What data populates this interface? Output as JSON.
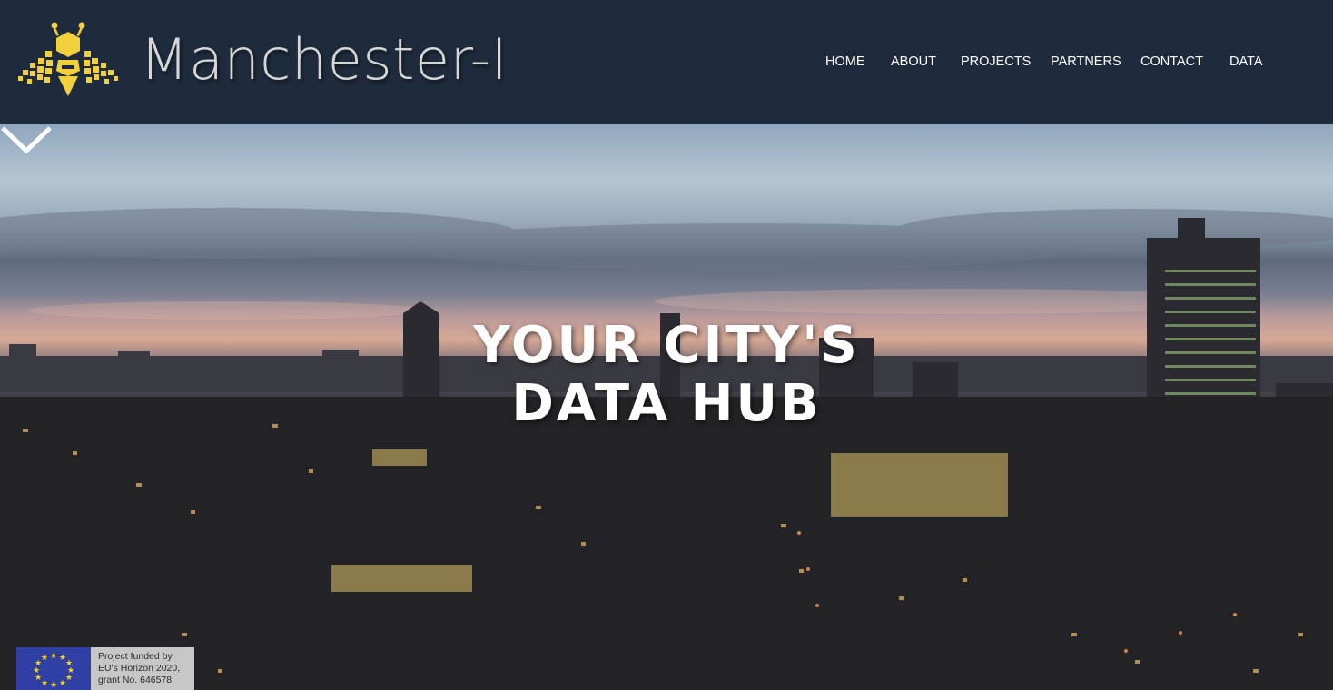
{
  "header": {
    "site_title": "Manchester-I",
    "logo_icon": "bee-logo-icon",
    "brand_color": "#f2d03b",
    "background_color": "#1e2b3c"
  },
  "nav": {
    "items": [
      {
        "label": "HOME"
      },
      {
        "label": "ABOUT"
      },
      {
        "label": "PROJECTS"
      },
      {
        "label": "PARTNERS"
      },
      {
        "label": "CONTACT"
      },
      {
        "label": "DATA"
      }
    ]
  },
  "hero": {
    "title_line1": "YOUR CITY'S",
    "title_line2": "DATA HUB",
    "scroll_icon": "chevron-down-icon"
  },
  "funding": {
    "flag_icon": "eu-flag-icon",
    "line1": "Project funded by",
    "line2": "EU's Horizon 2020,",
    "line3": "grant No. 646578"
  }
}
